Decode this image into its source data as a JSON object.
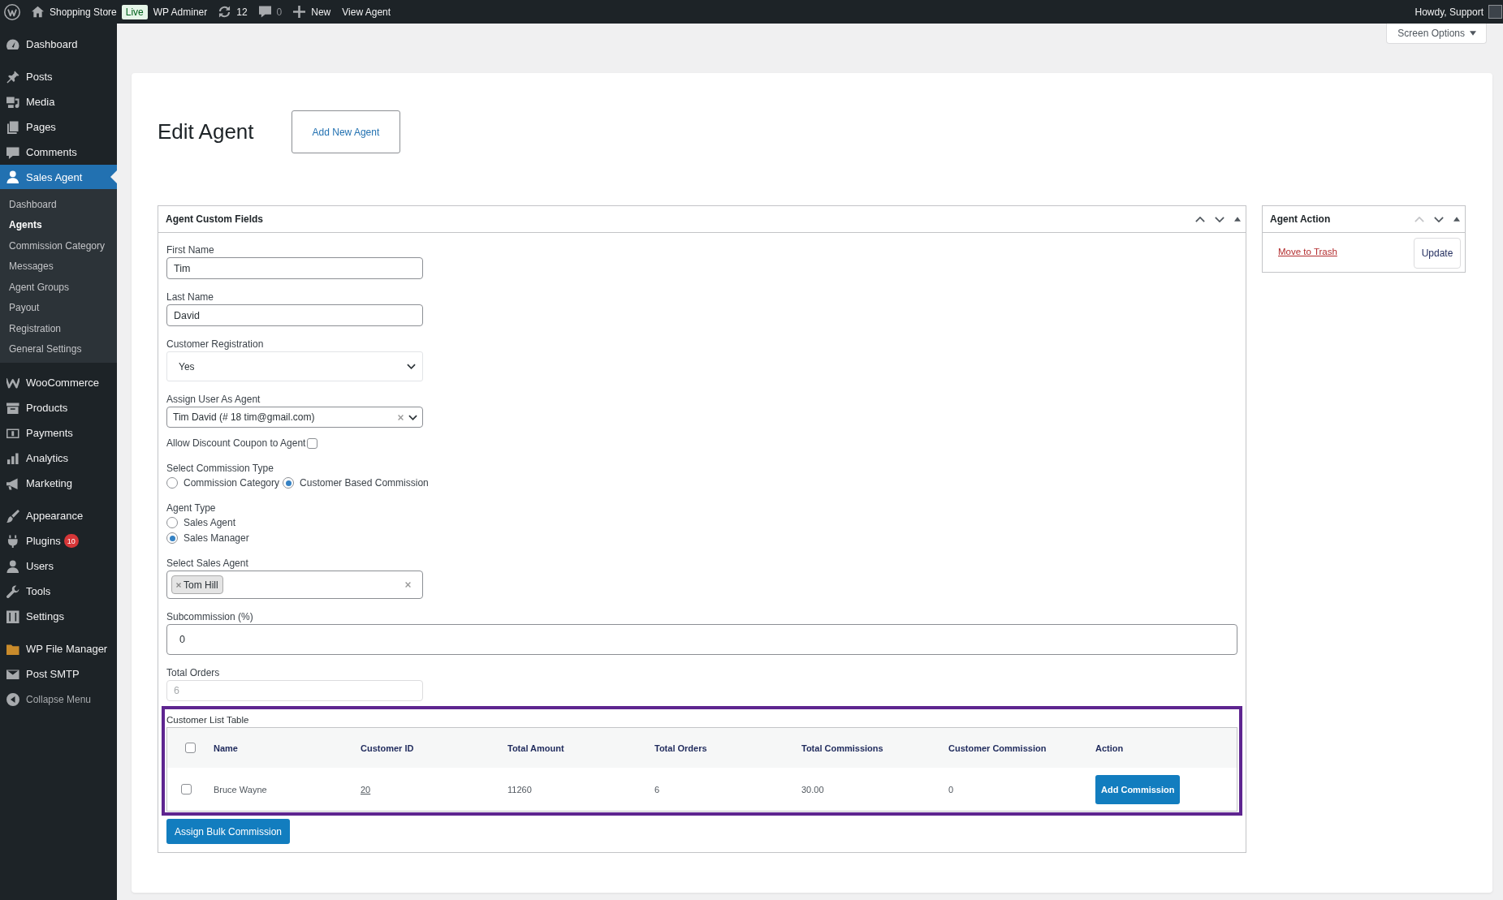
{
  "admin_bar": {
    "site": "Shopping Store",
    "badge": "Live",
    "items": [
      {
        "kind": "link",
        "label": "WP Adminer"
      },
      {
        "kind": "updates",
        "label": "12"
      },
      {
        "kind": "comments",
        "label": "0"
      },
      {
        "kind": "new",
        "label": "New"
      },
      {
        "kind": "link",
        "label": "View Agent"
      }
    ],
    "account": "Howdy, Support"
  },
  "sidebar": {
    "groups": [
      [
        {
          "label": "Dashboard",
          "selected": false
        }
      ],
      [
        {
          "label": "Posts",
          "selected": false
        },
        {
          "label": "Media",
          "selected": false
        },
        {
          "label": "Pages",
          "selected": false
        },
        {
          "label": "Comments",
          "selected": false
        },
        {
          "label": "Sales Agent",
          "selected": true,
          "children": [
            {
              "label": "Dashboard",
              "selected": false
            },
            {
              "label": "Agents",
              "selected": true
            },
            {
              "label": "Commission Category",
              "selected": false
            },
            {
              "label": "Messages",
              "selected": false
            },
            {
              "label": "Agent Groups",
              "selected": false
            },
            {
              "label": "Payout",
              "selected": false
            },
            {
              "label": "Registration",
              "selected": false
            },
            {
              "label": "General Settings",
              "selected": false
            }
          ]
        }
      ],
      [
        {
          "label": "WooCommerce",
          "selected": false
        },
        {
          "label": "Products",
          "selected": false
        },
        {
          "label": "Payments",
          "selected": false
        },
        {
          "label": "Analytics",
          "selected": false
        },
        {
          "label": "Marketing",
          "selected": false
        }
      ],
      [
        {
          "label": "Appearance",
          "selected": false
        },
        {
          "label": "Plugins",
          "selected": false,
          "badge": "10"
        },
        {
          "label": "Users",
          "selected": false
        },
        {
          "label": "Tools",
          "selected": false
        },
        {
          "label": "Settings",
          "selected": false
        }
      ],
      [
        {
          "label": "WP File Manager",
          "selected": false
        },
        {
          "label": "Post SMTP",
          "selected": false
        }
      ]
    ],
    "collapse": "Collapse Menu"
  },
  "screen_options": "Screen Options",
  "page": {
    "title": "Edit Agent",
    "add_new": "Add New Agent"
  },
  "fields_box": {
    "title": "Agent Custom Fields",
    "up_disabled": false,
    "fields": [
      {
        "kind": "text",
        "label": "First Name",
        "value": "Tim",
        "disabled": false
      },
      {
        "kind": "text",
        "label": "Last Name",
        "value": "David",
        "disabled": false
      },
      {
        "kind": "select",
        "label": "Customer Registration",
        "value": "Yes"
      },
      {
        "kind": "combobox",
        "label": "Assign User As Agent",
        "value": "Tim David (# 18 tim@gmail.com)"
      },
      {
        "kind": "checkbox",
        "label": "Allow Discount Coupon to Agent",
        "checked": false
      },
      {
        "kind": "radio_inline",
        "label": "Select Commission Type",
        "options": [
          {
            "label": "Commission Category",
            "selected": false
          },
          {
            "label": "Customer Based Commission",
            "selected": true
          }
        ]
      },
      {
        "kind": "radio_stacked",
        "label": "Agent Type",
        "options": [
          {
            "label": "Sales Agent",
            "selected": false
          },
          {
            "label": "Sales Manager",
            "selected": true
          }
        ]
      },
      {
        "kind": "tags",
        "label": "Select Sales Agent",
        "tags": [
          "Tom Hill"
        ]
      },
      {
        "kind": "number",
        "label": "Subcommission (%)",
        "value": "0",
        "disabled": false
      },
      {
        "kind": "text",
        "label": "Total Orders",
        "value": "6",
        "disabled": true
      },
      {
        "kind": "table",
        "label": "Customer List Table",
        "highlighted": true,
        "all_checked": false,
        "columns": [
          "Name",
          "Customer ID",
          "Total Amount",
          "Total Orders",
          "Total Commissions",
          "Customer Commission",
          "Action"
        ],
        "rows": [
          {
            "selected": false,
            "cells": [
              {
                "kind": "text",
                "text": "Bruce Wayne"
              },
              {
                "kind": "link",
                "text": "20"
              },
              {
                "kind": "text",
                "text": "11260"
              },
              {
                "kind": "text",
                "text": "6"
              },
              {
                "kind": "text",
                "text": "30.00"
              },
              {
                "kind": "text",
                "text": "0"
              },
              {
                "kind": "button",
                "text": "Add Commission"
              }
            ]
          }
        ]
      }
    ],
    "bulk_button": "Assign Bulk Commission"
  },
  "action_box": {
    "title": "Agent Action",
    "up_disabled": true,
    "trash_link": "Move to Trash",
    "update_button": "Update"
  }
}
